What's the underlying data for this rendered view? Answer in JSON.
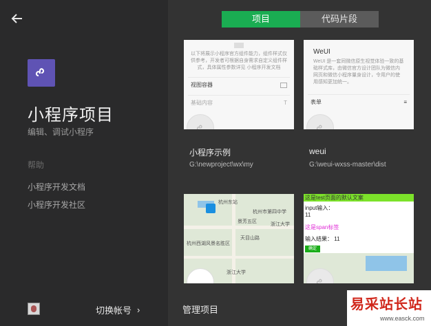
{
  "sidebar": {
    "title": "小程序项目",
    "subtitle": "编辑、调试小程序",
    "help_label": "帮助",
    "help_links": [
      "小程序开发文档",
      "小程序开发社区"
    ],
    "switch_account": "切换帐号",
    "switch_chevron": "›"
  },
  "tabs": [
    {
      "label": "项目",
      "active": true
    },
    {
      "label": "代码片段",
      "active": false
    }
  ],
  "projects": [
    {
      "name": "小程序示例",
      "path": "G:\\newproject\\wx\\my",
      "preview": {
        "text": "以下将展示小程序官方组件能力，组件样式仅供参考，开发者可根据自身需求自定义组件样式，具体属性参数详见 小程序开发文档",
        "rows": [
          "视图容器",
          "基础内容"
        ]
      }
    },
    {
      "name": "weui",
      "path": "G:\\weui-wxss-master\\dist",
      "preview": {
        "heading": "WeUI",
        "text": "WeUI 是一套同微信原生视觉体验一致的基础样式库，由微信官方设计团队为微信内网页和微信小程序量身设计，令用户的使用感知更加统一。",
        "rows": [
          "表单"
        ]
      }
    },
    {
      "name": "",
      "path": "",
      "preview": {
        "map_labels": [
          "杭州东站",
          "杭州市第四中学",
          "景芳五区",
          "浙江大学",
          "天目山路",
          "杭州西湖风景名胜区",
          "浙江大学"
        ]
      }
    },
    {
      "name": "",
      "path": "",
      "preview": {
        "banner": "这是test页面的默认文案",
        "input_label": "input输入：",
        "input_value": "11",
        "span_label": "这是span标签",
        "result_label": "输入结果：  11",
        "button": "确定"
      }
    }
  ],
  "manage_label": "管理项目",
  "watermark": {
    "title": "易采站长站",
    "url": "www.easck.com"
  },
  "colors": {
    "accent": "#1aad52",
    "logo": "#5f53b4",
    "sidebar": "#2a2a2b",
    "main": "#333333"
  },
  "icons": {
    "back": "arrow-left-icon",
    "logo": "mini-program-icon",
    "placeholder": "mini-program-icon"
  }
}
